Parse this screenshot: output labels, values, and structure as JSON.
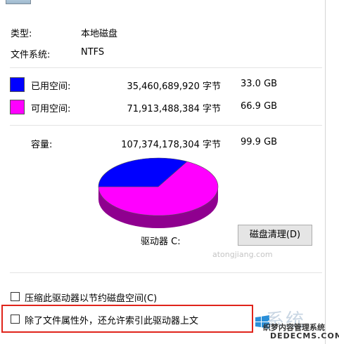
{
  "general": {
    "type_label": "类型:",
    "type_value": "本地磁盘",
    "fs_label": "文件系统:",
    "fs_value": "NTFS"
  },
  "space": {
    "used": {
      "label": "已用空间:",
      "bytes": "35,460,689,920 字节",
      "size": "33.0 GB",
      "color": "#0000ff",
      "fraction": 0.33
    },
    "free": {
      "label": "可用空间:",
      "bytes": "71,913,488,384 字节",
      "size": "66.9 GB",
      "color": "#ff00ff",
      "fraction": 0.67
    },
    "capacity": {
      "label": "容量:",
      "bytes": "107,374,178,304 字节",
      "size": "99.9 GB"
    }
  },
  "drive_label": "驱动器 C:",
  "cleanup_button": "磁盘清理(D)",
  "options": {
    "compress": "压缩此驱动器以节约磁盘空间(C)",
    "index": "除了文件属性外，还允许索引此驱动器上文"
  },
  "watermark": {
    "big": "系统",
    "cn": "织梦内容管理系统",
    "en": "DEDECMS.COM",
    "faint": "atongjiang.com"
  }
}
